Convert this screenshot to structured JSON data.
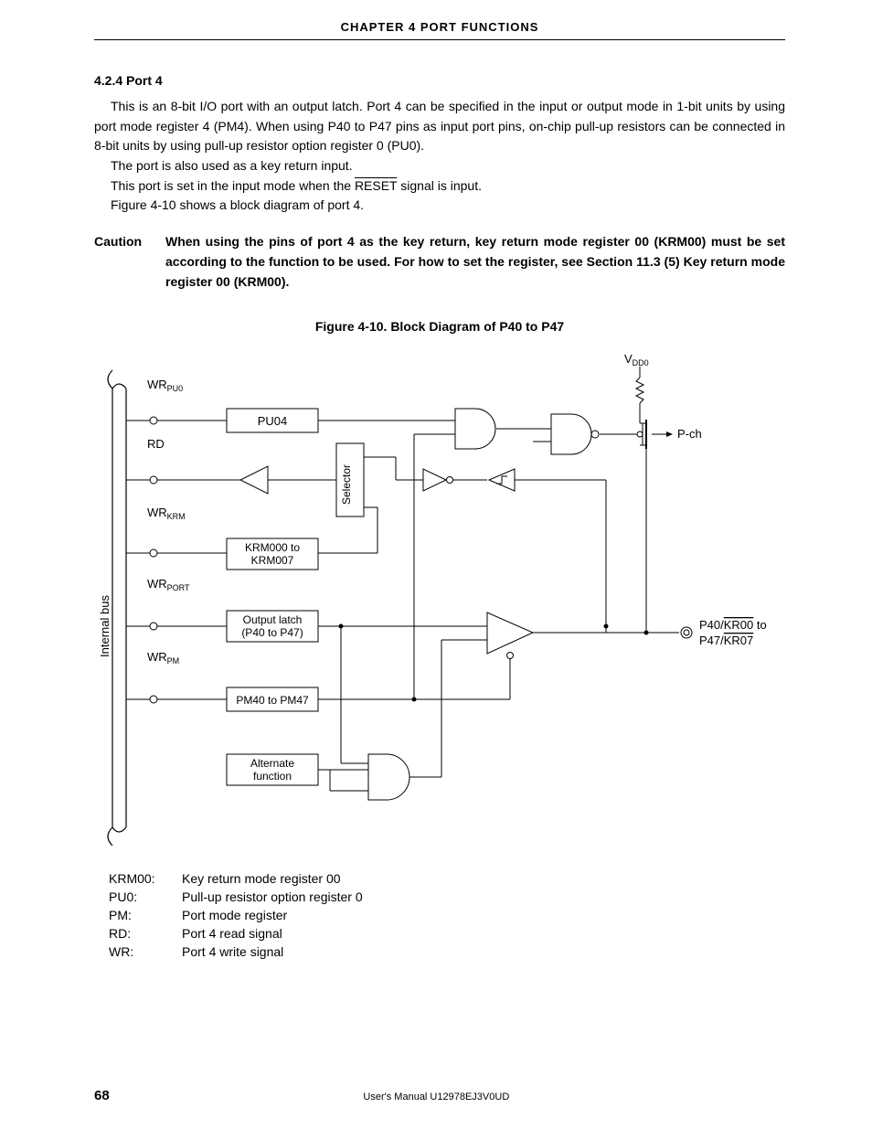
{
  "header": {
    "chapter": "CHAPTER  4    PORT  FUNCTIONS"
  },
  "section": {
    "number_title": "4.2.4   Port 4",
    "p1": "This is an 8-bit I/O port with an output latch.  Port 4 can be specified in the input or output mode in 1-bit units by using port mode register 4 (PM4).  When using P40 to P47 pins as input port pins, on-chip pull-up resistors can be connected in 8-bit units by using pull-up resistor option register 0 (PU0).",
    "p2": "The port is also used as a key return input.",
    "p3_before": "This port is set in the input mode when the ",
    "p3_reset": "RESET",
    "p3_after": " signal is input.",
    "p4": "Figure 4-10 shows a block diagram of port 4."
  },
  "caution": {
    "label": "Caution",
    "text": "When using the pins of port 4 as the key return, key return mode register 00 (KRM00) must be set according to the function to be used.  For how to set the register, see Section 11.3 (5) Key return mode register 00 (KRM00)."
  },
  "figure": {
    "title": "Figure 4-10.  Block Diagram of P40 to P47",
    "labels": {
      "internal_bus": "Internal bus",
      "wr_pu0": "WR",
      "wr_pu0_sub": "PU0",
      "rd": "RD",
      "wr_krm": "WR",
      "wr_krm_sub": "KRM",
      "wr_port": "WR",
      "wr_port_sub": "PORT",
      "wr_pm": "WR",
      "wr_pm_sub": "PM",
      "pu04": "PU04",
      "selector": "Selector",
      "krm000": "KRM000 to KRM007",
      "output_latch": "Output latch (P40 to P47)",
      "pm40": "PM40 to PM47",
      "alternate": "Alternate function",
      "vdd0": "V",
      "vdd0_sub": "DD0",
      "pch": "P-ch",
      "pin_a": "P40/",
      "pin_a_ov": "KR00",
      "pin_mid": " to",
      "pin_b": "P47/",
      "pin_b_ov": "KR07"
    }
  },
  "definitions": [
    {
      "key": "KRM00:",
      "val": "Key return mode register 00"
    },
    {
      "key": "PU0:",
      "val": "Pull-up resistor option register 0"
    },
    {
      "key": "PM:",
      "val": "Port mode register"
    },
    {
      "key": "RD:",
      "val": "Port 4 read signal"
    },
    {
      "key": "WR:",
      "val": "Port 4 write signal"
    }
  ],
  "footer": {
    "page": "68",
    "manual": "User's Manual  U12978EJ3V0UD"
  }
}
